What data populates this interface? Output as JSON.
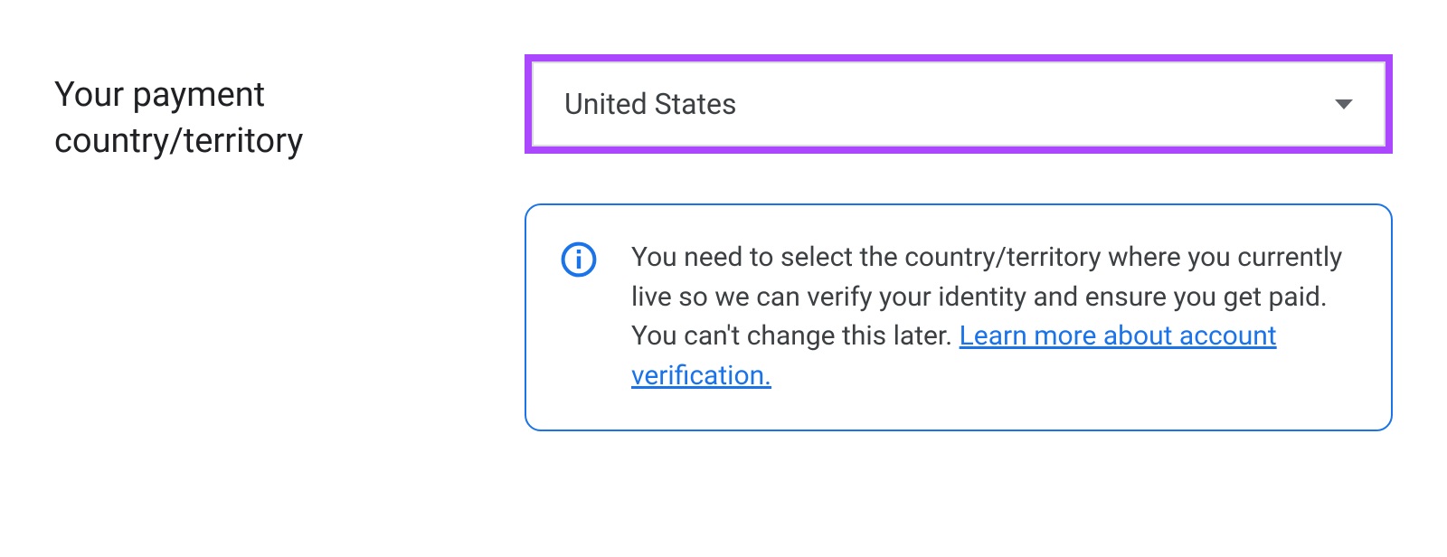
{
  "form": {
    "label": "Your payment country/territory",
    "select": {
      "value": "United States"
    },
    "info": {
      "text": "You need to select the country/territory where you currently live so we can verify your identity and ensure you get paid. You can't change this later. ",
      "link_text": "Learn more about account verification."
    }
  }
}
